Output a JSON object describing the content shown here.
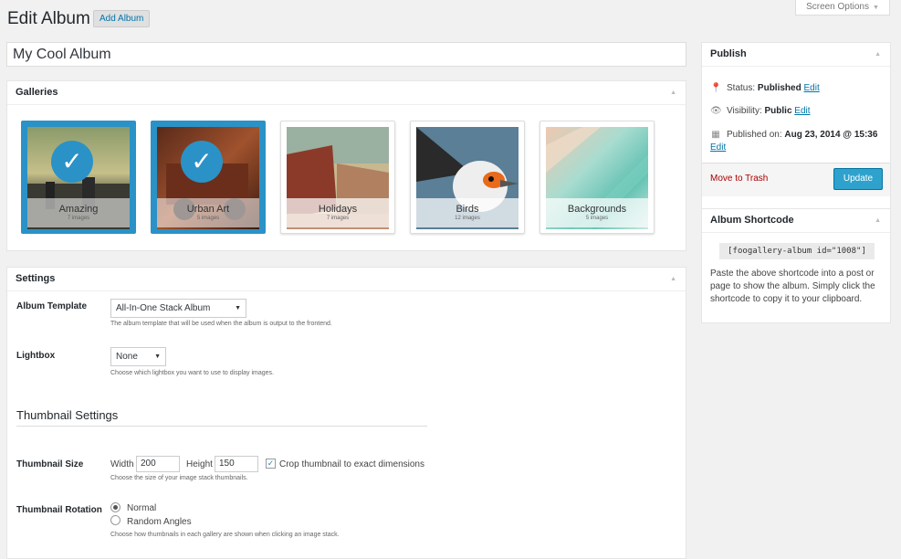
{
  "header": {
    "title": "Edit Album",
    "add_button": "Add Album",
    "screen_options": "Screen Options"
  },
  "album_title": "My Cool Album",
  "galleries": {
    "heading": "Galleries",
    "items": [
      {
        "name": "Amazing",
        "count": "7 images",
        "selected": true
      },
      {
        "name": "Urban Art",
        "count": "5 images",
        "selected": true
      },
      {
        "name": "Holidays",
        "count": "7 images",
        "selected": false
      },
      {
        "name": "Birds",
        "count": "12 images",
        "selected": false
      },
      {
        "name": "Backgrounds",
        "count": "5 images",
        "selected": false
      }
    ]
  },
  "settings": {
    "heading": "Settings",
    "album_template": {
      "label": "Album Template",
      "value": "All-In-One Stack Album",
      "description": "The album template that will be used when the album is output to the frontend."
    },
    "lightbox": {
      "label": "Lightbox",
      "value": "None",
      "description": "Choose which lightbox you want to use to display images."
    },
    "thumbnail_heading": "Thumbnail Settings",
    "thumbnail_size": {
      "label": "Thumbnail Size",
      "width_label": "Width",
      "width": "200",
      "height_label": "Height",
      "height": "150",
      "crop_label": "Crop thumbnail to exact dimensions",
      "description": "Choose the size of your image stack thumbnails."
    },
    "thumbnail_rotation": {
      "label": "Thumbnail Rotation",
      "options": [
        "Normal",
        "Random Angles"
      ],
      "selected": "Normal",
      "description": "Choose how thumbnails in each gallery are shown when clicking an image stack."
    }
  },
  "publish": {
    "heading": "Publish",
    "status_label": "Status:",
    "status_value": "Published",
    "visibility_label": "Visibility:",
    "visibility_value": "Public",
    "published_label": "Published on:",
    "published_value": "Aug 23, 2014 @ 15:36",
    "edit": "Edit",
    "trash": "Move to Trash",
    "update": "Update"
  },
  "shortcode_box": {
    "heading": "Album Shortcode",
    "code": "[foogallery-album id=\"1008\"]",
    "description": "Paste the above shortcode into a post or page to show the album. Simply click the shortcode to copy it to your clipboard."
  },
  "colors": {
    "accent": "#2a92c7",
    "link": "#0073aa",
    "update_button": "#2ea2cc",
    "trash": "#a00000"
  }
}
